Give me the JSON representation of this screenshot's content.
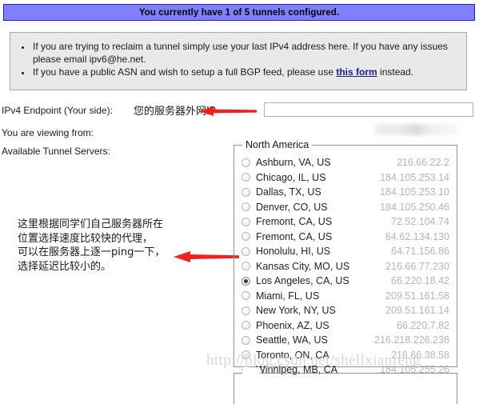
{
  "banner": {
    "text": "You currently have 1 of 5 tunnels configured."
  },
  "notice": {
    "bullet1_before": "If you are trying to reclaim a tunnel simply use your last IPv4 address here. If you have any issues please email ipv6@he.net.",
    "bullet2_before": "If you have a public ASN and wish to setup a full BGP feed, please use ",
    "bullet2_link": "this form",
    "bullet2_after": " instead."
  },
  "form": {
    "endpoint_label": "IPv4 Endpoint (Your side):",
    "endpoint_value": "",
    "endpoint_placeholder": "",
    "viewing_from_label": "You are viewing from:",
    "available_servers_label": "Available Tunnel Servers:"
  },
  "annotations": {
    "endpoint_note": "您的服务器外网IP",
    "server_note": "这里根据同学们自己服务器所在\n位置选择速度比较快的代理，\n可以在服务器上逐一ping一下，\n选择延迟比较小的。",
    "arrow_color": "#f22020"
  },
  "servers": {
    "legend": "North America",
    "selected_index": 8,
    "items": [
      {
        "name": "Ashburn, VA, US",
        "ip": "216.66.22.2",
        "selected": false
      },
      {
        "name": "Chicago, IL, US",
        "ip": "184.105.253.14",
        "selected": false
      },
      {
        "name": "Dallas, TX, US",
        "ip": "184.105.253.10",
        "selected": false
      },
      {
        "name": "Denver, CO, US",
        "ip": "184.105.250.46",
        "selected": false
      },
      {
        "name": "Fremont, CA, US",
        "ip": "72.52.104.74",
        "selected": false
      },
      {
        "name": "Fremont, CA, US",
        "ip": "64.62.134.130",
        "selected": false
      },
      {
        "name": "Honolulu, HI, US",
        "ip": "64.71.156.86",
        "selected": false
      },
      {
        "name": "Kansas City, MO, US",
        "ip": "216.66.77.230",
        "selected": false
      },
      {
        "name": "Los Angeles, CA, US",
        "ip": "66.220.18.42",
        "selected": true
      },
      {
        "name": "Miami, FL, US",
        "ip": "209.51.161.58",
        "selected": false
      },
      {
        "name": "New York, NY, US",
        "ip": "209.51.161.14",
        "selected": false
      },
      {
        "name": "Phoenix, AZ, US",
        "ip": "66.220.7.82",
        "selected": false
      },
      {
        "name": "Seattle, WA, US",
        "ip": "216.218.226.238",
        "selected": false
      },
      {
        "name": "Toronto, ON, CA",
        "ip": "216.66.38.58",
        "selected": false
      },
      {
        "name": "Winnipeg, MB, CA",
        "ip": "184.105.255.26",
        "selected": false
      }
    ]
  },
  "watermark": {
    "text": "http://blog.csdn.net/shellxianfeng"
  },
  "colors": {
    "banner_bg": "#8080ff",
    "banner_border": "#2222cc",
    "notice_bg": "#e9e9e9",
    "notice_border": "#a8a8a8",
    "link": "#1a1a8c",
    "ip_text": "#b4b4b4",
    "arrow": "#f22020"
  }
}
